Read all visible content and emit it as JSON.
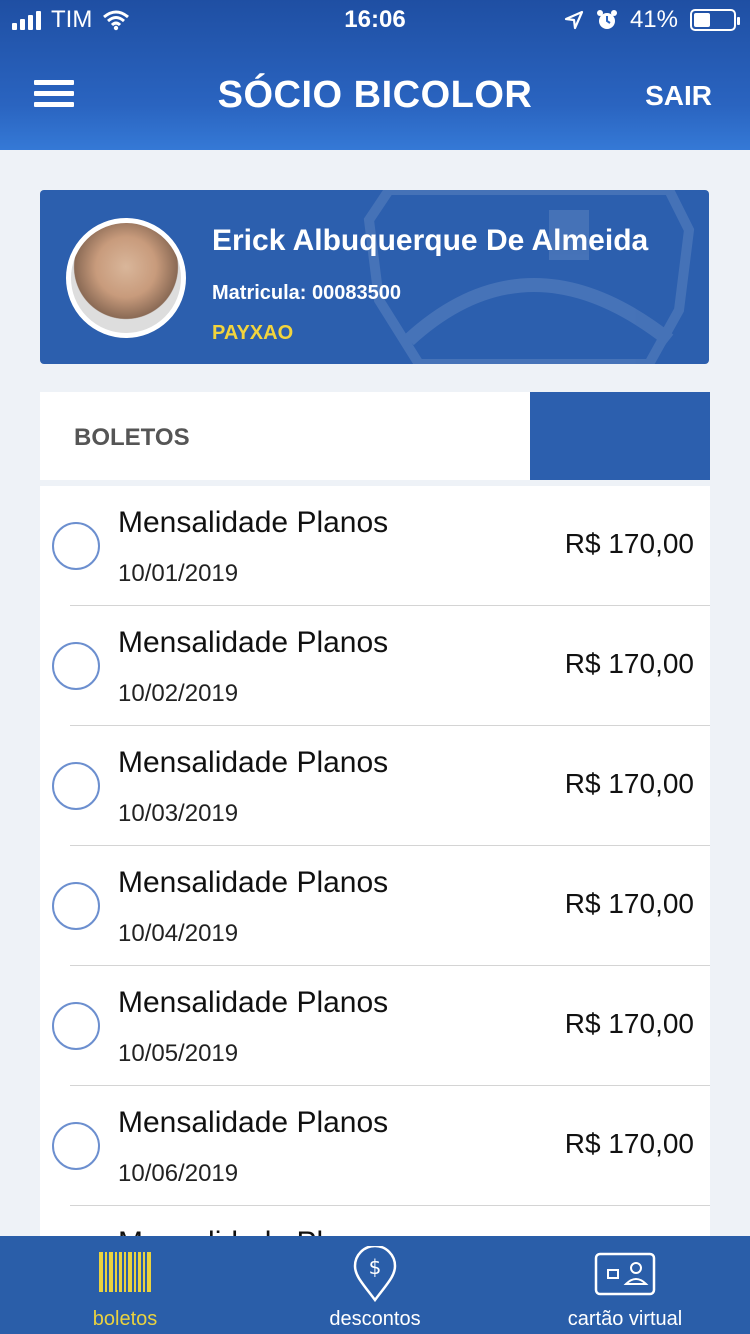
{
  "status_bar": {
    "carrier": "TIM",
    "time": "16:06",
    "battery": "41%",
    "battery_level": 0.41
  },
  "header": {
    "title": "SÓCIO BICOLOR",
    "logout_label": "SAIR"
  },
  "profile": {
    "name": "Erick Albuquerque De Almeida",
    "registration": "Matricula: 00083500",
    "plan": "PAYXAO"
  },
  "boletos": {
    "section_label": "BOLETOS",
    "items": [
      {
        "description": "Mensalidade Planos",
        "date": "10/01/2019",
        "amount": "R$ 170,00"
      },
      {
        "description": "Mensalidade Planos",
        "date": "10/02/2019",
        "amount": "R$ 170,00"
      },
      {
        "description": "Mensalidade Planos",
        "date": "10/03/2019",
        "amount": "R$ 170,00"
      },
      {
        "description": "Mensalidade Planos",
        "date": "10/04/2019",
        "amount": "R$ 170,00"
      },
      {
        "description": "Mensalidade Planos",
        "date": "10/05/2019",
        "amount": "R$ 170,00"
      },
      {
        "description": "Mensalidade Planos",
        "date": "10/06/2019",
        "amount": "R$ 170,00"
      },
      {
        "description": "Mensalidade Planos",
        "date": "",
        "amount": ""
      }
    ]
  },
  "tabs": [
    {
      "label": "boletos",
      "icon": "barcode-icon",
      "active": true
    },
    {
      "label": "descontos",
      "icon": "discount-pin-icon",
      "active": false
    },
    {
      "label": "cartão virtual",
      "icon": "id-card-icon",
      "active": false
    }
  ],
  "colors": {
    "primary": "#2c5fae",
    "accent_yellow": "#e9d23f"
  }
}
